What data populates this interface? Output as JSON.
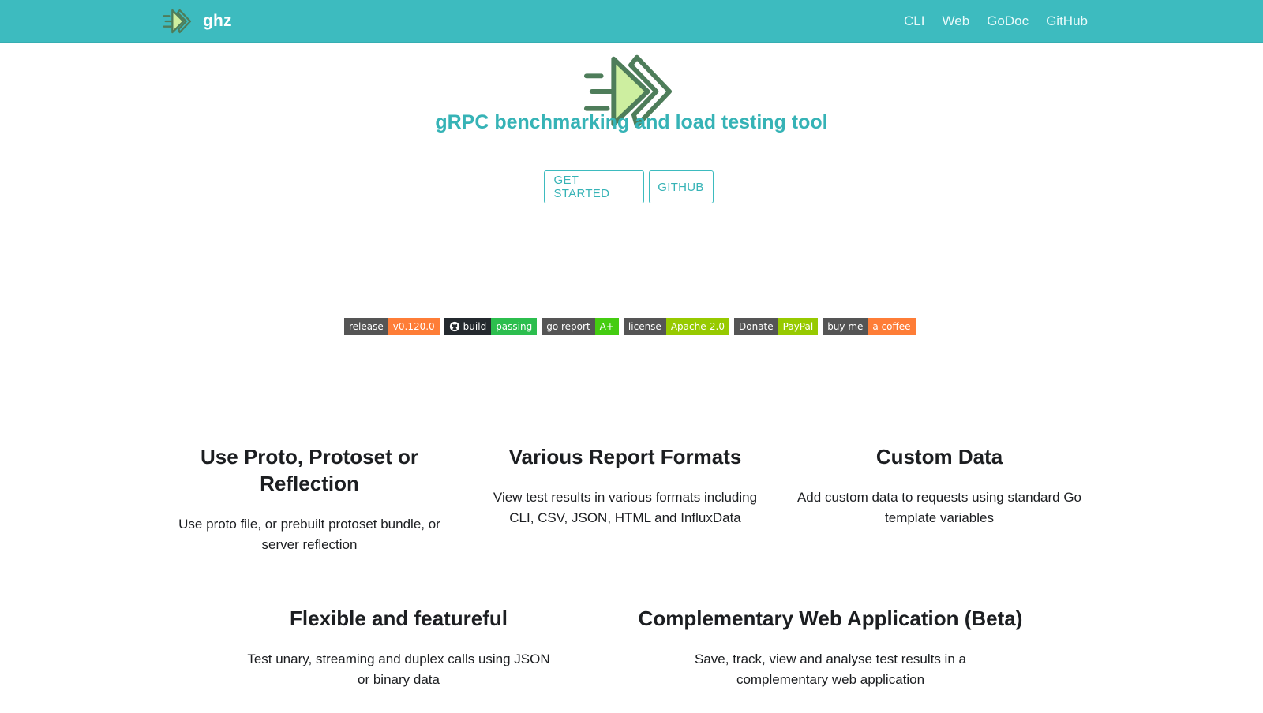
{
  "navbar": {
    "brand_title": "ghz",
    "brand_icon": "ghz-logo-icon",
    "links": [
      {
        "label": "CLI"
      },
      {
        "label": "Web"
      },
      {
        "label": "GoDoc"
      },
      {
        "label": "GitHub"
      }
    ]
  },
  "hero": {
    "logo_icon": "ghz-logo-icon",
    "tagline": "gRPC benchmarking and load testing tool",
    "buttons": {
      "get_started": "GET STARTED",
      "github": "GITHUB"
    }
  },
  "badges": [
    {
      "left": "release",
      "right": "v0.120.0",
      "color": "#fe7d37"
    },
    {
      "left": "build",
      "right": "passing",
      "color": "#2cbe4e",
      "icon": "github-icon"
    },
    {
      "left": "go report",
      "right": "A+",
      "color": "#44cc11"
    },
    {
      "left": "license",
      "right": "Apache-2.0",
      "color": "#97ca00"
    },
    {
      "left": "Donate",
      "right": "PayPal",
      "color": "#97ca00"
    },
    {
      "left": "buy me",
      "right": "a coffee",
      "color": "#fe7d37"
    }
  ],
  "features": [
    {
      "title": "Use Proto, Protoset or Reflection",
      "text": "Use proto file, or prebuilt protoset bundle, or server reflection"
    },
    {
      "title": "Various Report Formats",
      "text": "View test results in various formats including CLI, CSV, JSON, HTML and InfluxData"
    },
    {
      "title": "Custom Data",
      "text": "Add custom data to requests using standard Go template variables"
    },
    {
      "title": "Flexible and featureful",
      "text": "Test unary, streaming and duplex calls using JSON or binary data"
    },
    {
      "title": "Complementary Web Application (Beta)",
      "text": "Save, track, view and analyse test results in a complementary web application"
    }
  ],
  "colors": {
    "primary": "#3dbbbf",
    "logo_dark": "#4e7d5a",
    "logo_light": "#cdeea0"
  }
}
